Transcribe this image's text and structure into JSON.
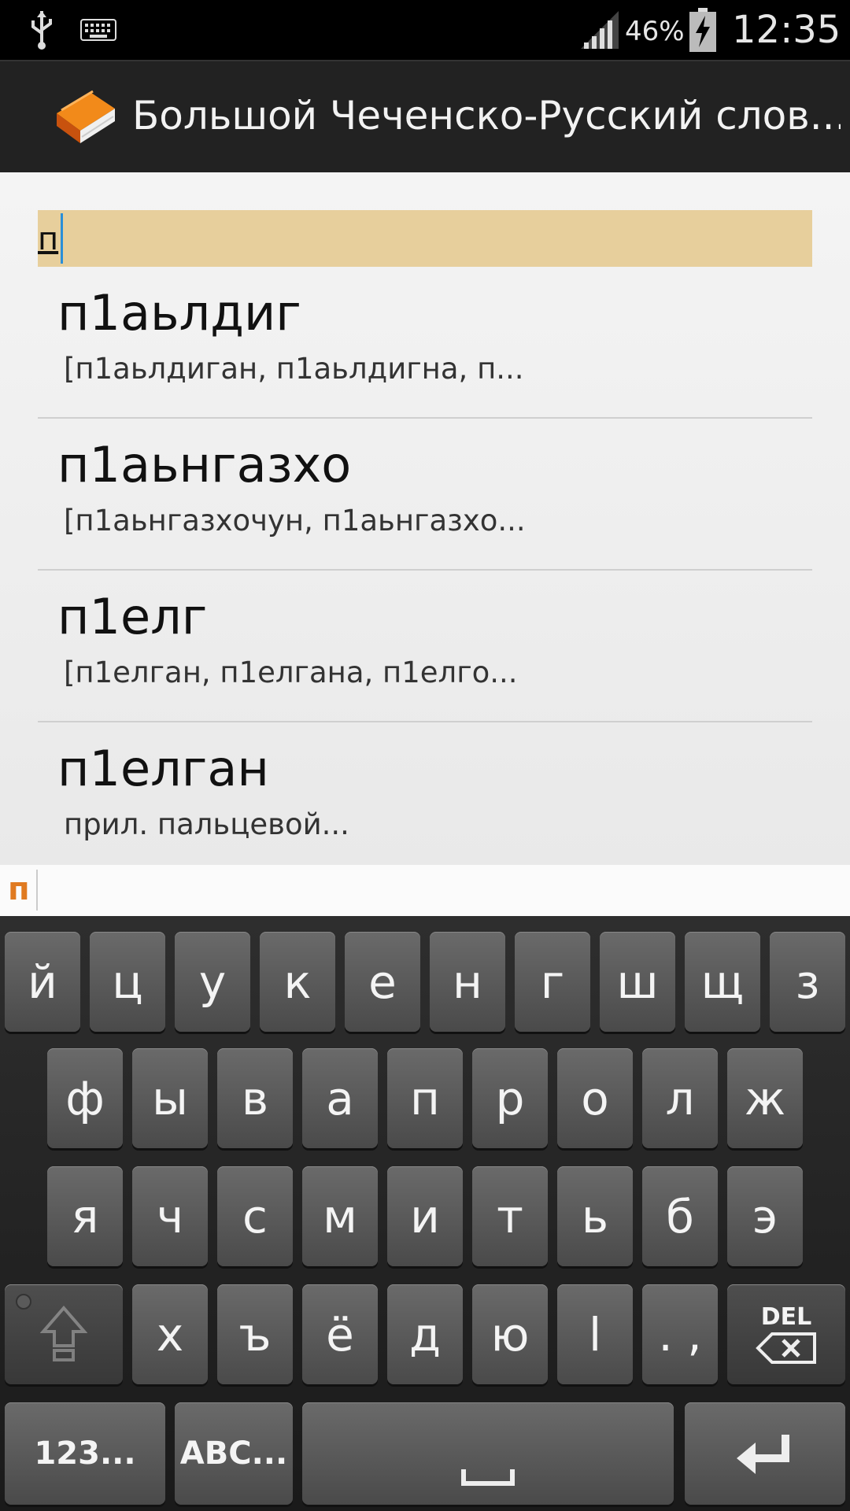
{
  "status_bar": {
    "battery_percent": "46%",
    "time": "12:35",
    "icons": [
      "usb-icon",
      "keyboard-icon",
      "signal-icon",
      "battery-charging-icon"
    ]
  },
  "app_bar": {
    "title": "Большой Чеченско-Русский слов...",
    "icon": "book-icon"
  },
  "search": {
    "value": "п"
  },
  "entries": [
    {
      "word": "п1аьлдиг",
      "sub": "[п1аьлдиган, п1аьлдигна, п..."
    },
    {
      "word": "п1аьнгазхо",
      "sub": "[п1аьнгазхочун, п1аьнгазхо..."
    },
    {
      "word": "п1елг",
      "sub": "[п1елган, п1елгана, п1елго..."
    },
    {
      "word": "п1елган",
      "sub": "прил. пальцевой..."
    }
  ],
  "candidate": "п",
  "keyboard": {
    "row1": [
      "й",
      "ц",
      "у",
      "к",
      "е",
      "н",
      "г",
      "ш",
      "щ",
      "з"
    ],
    "row2": [
      "ф",
      "ы",
      "в",
      "а",
      "п",
      "р",
      "о",
      "л",
      "ж"
    ],
    "row3": [
      "я",
      "ч",
      "с",
      "м",
      "и",
      "т",
      "ь",
      "б",
      "э"
    ],
    "row4": [
      "х",
      "ъ",
      "ё",
      "д",
      "ю",
      "l",
      ". ,"
    ],
    "del_label": "DEL",
    "numbers_label": "123...",
    "abc_label": "ABC..."
  },
  "colors": {
    "search_bg": "#e7cf9c",
    "cursor": "#2a8fd8",
    "candidate": "#e07a20"
  }
}
